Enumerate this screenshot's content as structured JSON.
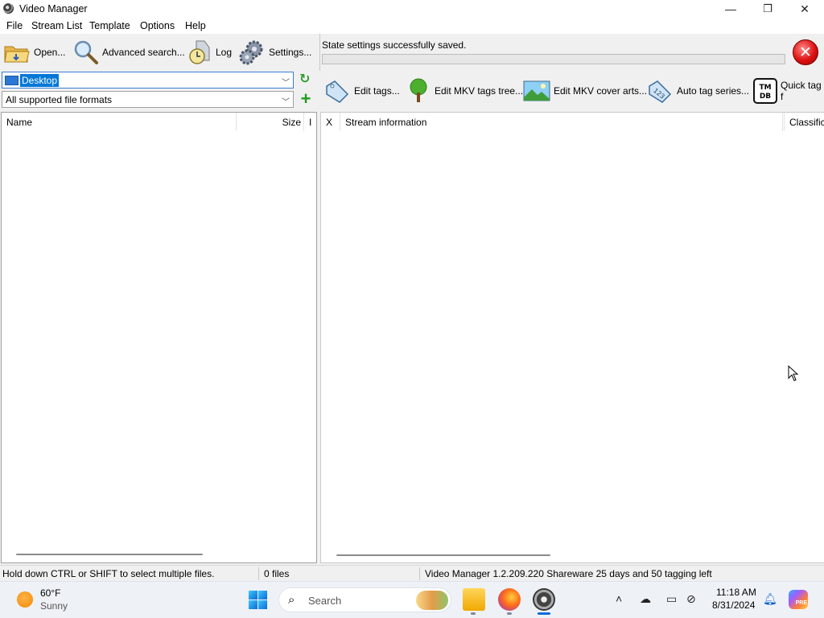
{
  "window": {
    "title": "Video Manager",
    "controls": {
      "minimize": "—",
      "restore": "❐",
      "close": "✕"
    }
  },
  "menu": [
    "File",
    "Stream List",
    "Template",
    "Options",
    "Help"
  ],
  "toolbar": {
    "open_label": "Open...",
    "advanced_search_label": "Advanced search...",
    "log_label": "Log",
    "settings_label": "Settings..."
  },
  "status_panel": {
    "message": "State settings successfully saved.",
    "progress": 0.0
  },
  "left_pane": {
    "location": "Desktop",
    "file_filter": "All supported file formats",
    "columns": [
      "Name",
      "Size",
      "I"
    ]
  },
  "right_toolbar": {
    "edit_tags_label": "Edit tags...",
    "edit_mkv_tags_tree_label": "Edit MKV tags tree...",
    "edit_mkv_cover_arts_label": "Edit MKV cover arts...",
    "auto_tag_series_label": "Auto tag series...",
    "quick_tag_label": "Quick tag f",
    "tmdb_icon_text": "TM DB"
  },
  "right_pane": {
    "columns": [
      "X",
      "Stream information",
      "Classifica"
    ]
  },
  "statusbar": {
    "hint": "Hold down CTRL or SHIFT to select multiple files.",
    "file_count": "0 files",
    "version_info": "Video Manager 1.2.209.220 Shareware 25 days and 50 tagging left"
  },
  "taskbar": {
    "weather": {
      "temp": "60°F",
      "condition": "Sunny"
    },
    "search_placeholder": "Search",
    "clock": {
      "time": "11:18 AM",
      "date": "8/31/2024"
    },
    "copilot_badge": "PRE"
  },
  "colors": {
    "accent": "#0078d7",
    "progress": "#06b025",
    "close_red": "#d11111"
  }
}
